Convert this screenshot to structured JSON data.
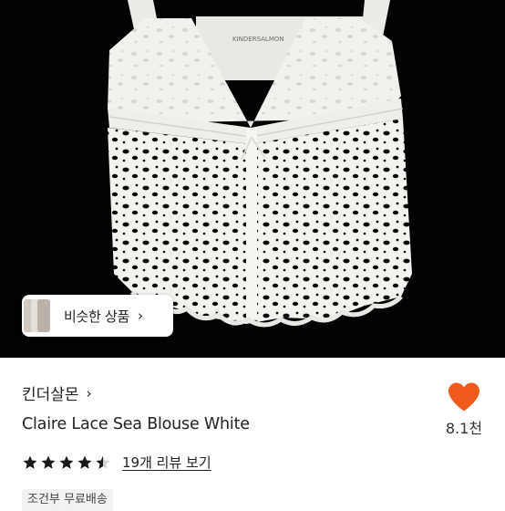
{
  "product_image": {
    "subject": "white eyelet lace sleeveless blouse on black background",
    "label_text": "KINDERSALMON"
  },
  "similar_button": {
    "label": "비슷한 상품",
    "chevron": "›"
  },
  "store": {
    "name": "킨더살몬",
    "chevron": "›"
  },
  "product": {
    "title": "Claire Lace Sea Blouse White"
  },
  "like": {
    "icon": "heart-icon",
    "count": "8.1천",
    "color": "#f05a1c"
  },
  "rating": {
    "value": 4.5,
    "max": 5,
    "review_link": "19개 리뷰 보기"
  },
  "shipping_badge": "조건부 무료배송"
}
